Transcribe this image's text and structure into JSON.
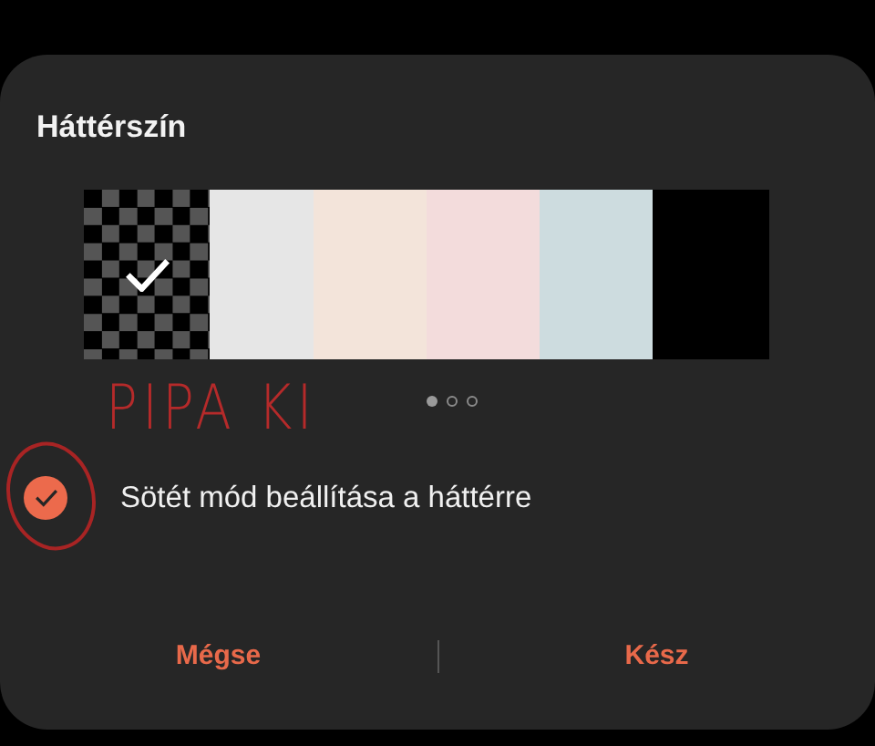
{
  "dialog": {
    "title": "Háttérszín",
    "swatches": [
      {
        "kind": "checker",
        "selected": true
      },
      {
        "kind": "solid",
        "color": "#e6e6e6",
        "selected": false
      },
      {
        "kind": "solid",
        "color": "#f3e4da",
        "selected": false
      },
      {
        "kind": "solid",
        "color": "#f3dcdc",
        "selected": false
      },
      {
        "kind": "solid",
        "color": "#cddcdf",
        "selected": false
      },
      {
        "kind": "solid",
        "color": "#000000",
        "selected": false
      }
    ],
    "pages": [
      {
        "selected": true
      },
      {
        "selected": false
      },
      {
        "selected": false
      }
    ],
    "dark_mode": {
      "label": "Sötét mód beállítása a háttérre",
      "checked": true
    },
    "buttons": [
      "Mégse",
      "Kész"
    ]
  },
  "annotation": {
    "text": "PIPA KI"
  }
}
